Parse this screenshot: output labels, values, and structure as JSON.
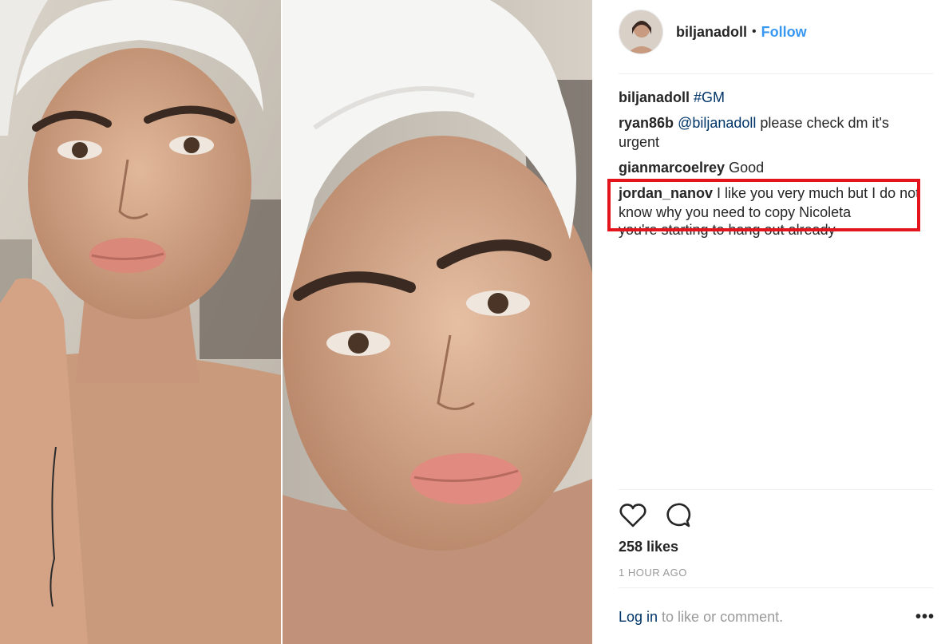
{
  "post": {
    "author": "biljanadoll",
    "dot": "•",
    "follow_label": "Follow"
  },
  "comments": [
    {
      "username": "biljanadoll",
      "tag": "#GM",
      "text": ""
    },
    {
      "username": "ryan86b",
      "tag": "@biljanadoll",
      "text": " please check dm it's urgent"
    },
    {
      "username": "gianmarcoelrey",
      "tag": "",
      "text": " Good"
    },
    {
      "username": "jordan_nanov",
      "tag": "",
      "text": " I like you very much but I do not know why you need to copy Nicoleta"
    },
    {
      "username": "",
      "tag": "",
      "text": "you're starting to hang out already"
    }
  ],
  "actions": {
    "like_icon": "heart-icon",
    "comment_icon": "speech-bubble-icon"
  },
  "likes_label": "258 likes",
  "timestamp": "1 HOUR AGO",
  "footer": {
    "login_link": "Log in",
    "login_text": " to like or comment.",
    "more_label": "•••"
  },
  "colors": {
    "follow": "#3897f0",
    "link": "#003569",
    "highlight": "#e3141b",
    "muted": "#999999"
  }
}
